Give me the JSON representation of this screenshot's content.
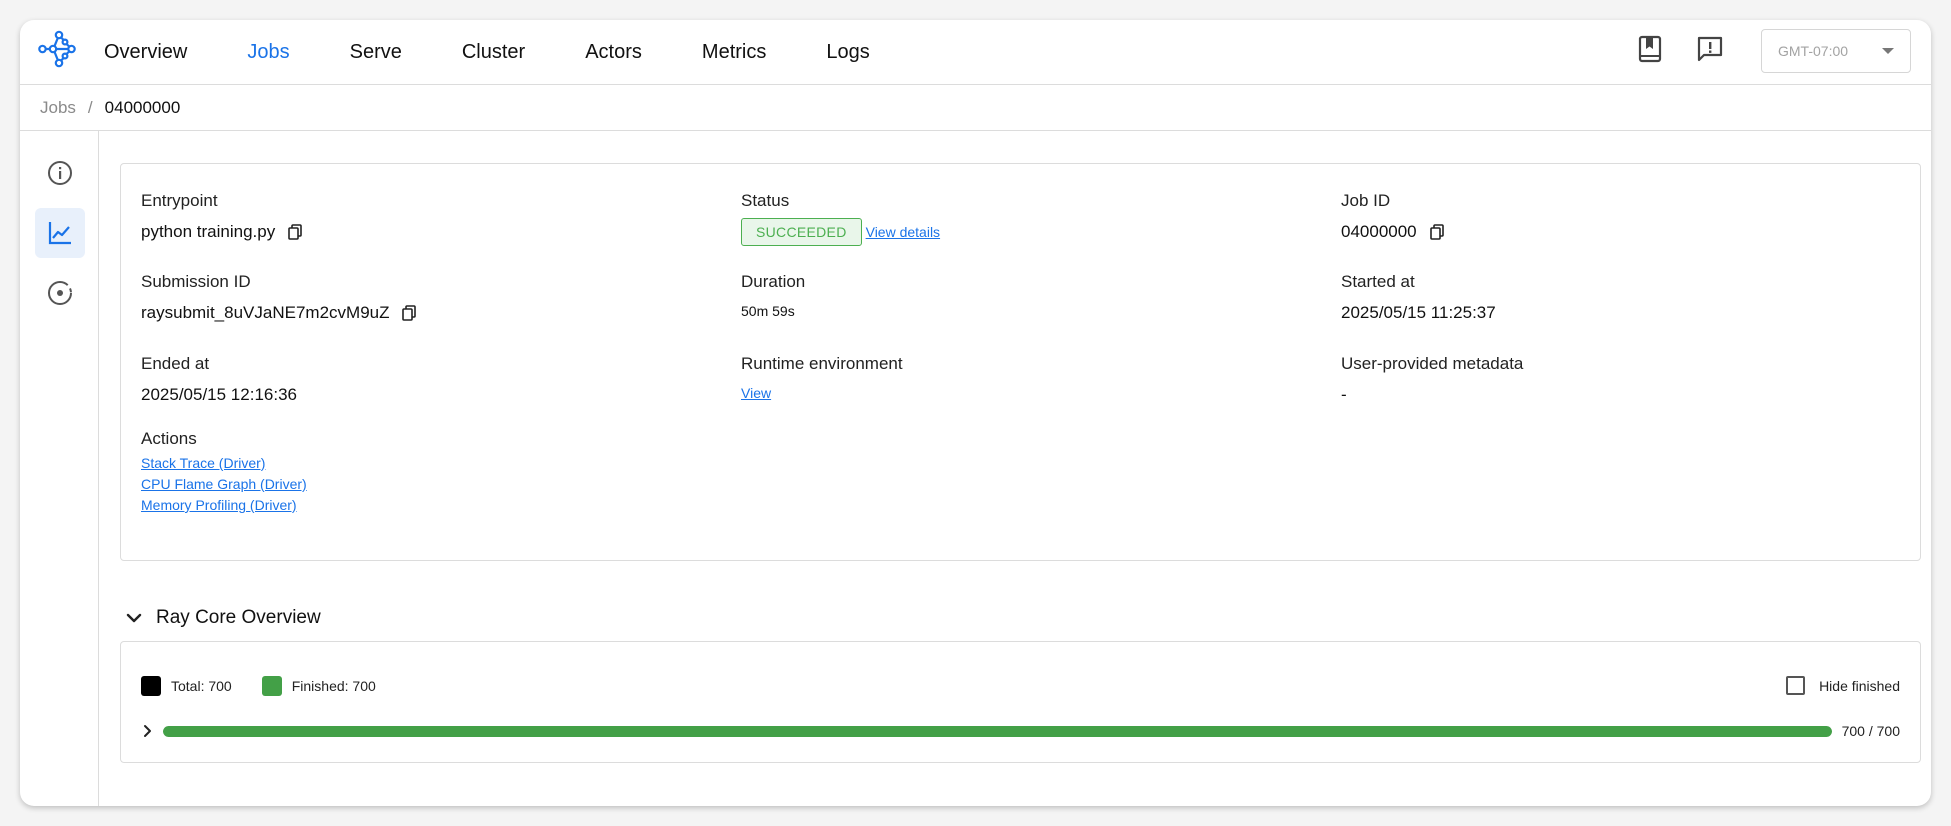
{
  "nav": {
    "tabs": [
      {
        "label": "Overview"
      },
      {
        "label": "Jobs"
      },
      {
        "label": "Serve"
      },
      {
        "label": "Cluster"
      },
      {
        "label": "Actors"
      },
      {
        "label": "Metrics"
      },
      {
        "label": "Logs"
      }
    ],
    "active_tab": "Jobs",
    "timezone": "GMT-07:00",
    "icons": [
      "docs-book-icon",
      "feedback-icon"
    ]
  },
  "breadcrumb": {
    "parent": "Jobs",
    "separator": "/",
    "current": "04000000"
  },
  "sidebar": {
    "items": [
      {
        "icon": "info-icon",
        "active": false
      },
      {
        "icon": "chart-line-icon",
        "active": true
      },
      {
        "icon": "record-circle-icon",
        "active": false
      }
    ]
  },
  "job": {
    "entrypoint_label": "Entrypoint",
    "entrypoint": "python training.py",
    "status_label": "Status",
    "status": "SUCCEEDED",
    "view_details": "View details",
    "job_id_label": "Job ID",
    "job_id": "04000000",
    "submission_id_label": "Submission ID",
    "submission_id": "raysubmit_8uVJaNE7m2cvM9uZ",
    "duration_label": "Duration",
    "duration": "50m 59s",
    "started_label": "Started at",
    "started": "2025/05/15 11:25:37",
    "ended_label": "Ended at",
    "ended": "2025/05/15 12:16:36",
    "runtime_env_label": "Runtime environment",
    "runtime_env_link": "View",
    "metadata_label": "User-provided metadata",
    "metadata": "-",
    "actions_label": "Actions",
    "actions": [
      {
        "label": "Stack Trace (Driver)"
      },
      {
        "label": "CPU Flame Graph (Driver)"
      },
      {
        "label": "Memory Profiling (Driver)"
      }
    ]
  },
  "ray_core": {
    "title": "Ray Core Overview",
    "legend_total": "Total: 700",
    "legend_finished": "Finished: 700",
    "hide_finished": "Hide finished",
    "progress_text": "700 / 700",
    "progress_fraction": 1.0
  },
  "colors": {
    "accent": "#1a73e8",
    "success": "#43a047",
    "total_swatch": "#000000"
  }
}
